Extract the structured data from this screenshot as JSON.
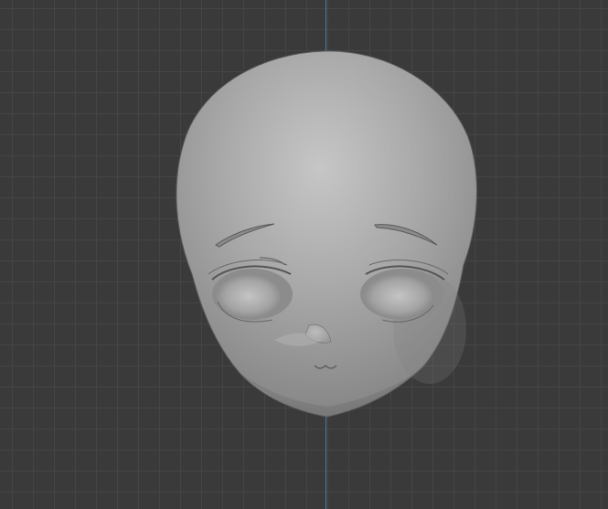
{
  "viewport": {
    "grid_visible": true,
    "axis": "Y"
  },
  "scene": {
    "object": "head-sculpt",
    "shading": "solid",
    "colors": {
      "background": "#3a3a3a",
      "grid_line": "#454545",
      "axis_y": "#4f7fbf",
      "mesh_base": "#9a9a9a",
      "mesh_highlight": "#c8c8c8",
      "mesh_shadow": "#5c5c5c"
    }
  }
}
